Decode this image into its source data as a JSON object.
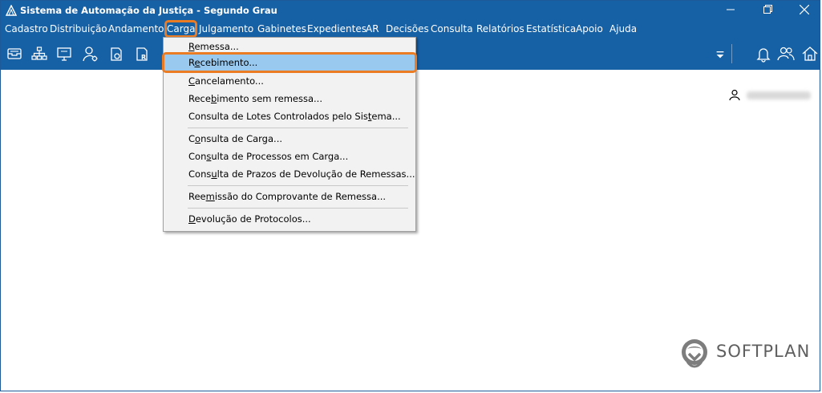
{
  "window": {
    "title": "Sistema de Automação da Justiça - Segundo Grau",
    "controls": [
      "minimize",
      "restore",
      "close"
    ]
  },
  "menubar": {
    "items": [
      {
        "label": "Cadastro"
      },
      {
        "label": "Distribuição"
      },
      {
        "label": "Andamento"
      },
      {
        "label": "Carga",
        "active": true
      },
      {
        "label": "Julgamento"
      },
      {
        "label": "Gabinetes"
      },
      {
        "label": "Expedientes"
      },
      {
        "label": "AR"
      },
      {
        "label": "Decisões"
      },
      {
        "label": "Consulta"
      },
      {
        "label": "Relatórios"
      },
      {
        "label": "Estatística"
      },
      {
        "label": "Apoio"
      },
      {
        "label": "Ajuda"
      }
    ]
  },
  "toolbar": {
    "icons": [
      "inbox-icon",
      "hierarchy-icon",
      "monitor-icon",
      "user-settings-icon",
      "document-o-icon",
      "document-r-icon"
    ],
    "right_icons": [
      "dropdown-arrow-icon",
      "bell-icon",
      "users-icon",
      "home-icon"
    ]
  },
  "carga_menu": {
    "items": [
      {
        "label": "Remessa...",
        "mnemonic_index": 0
      },
      {
        "label": "Recebimento...",
        "mnemonic_index": 1,
        "highlighted": true
      },
      {
        "label": "Cancelamento...",
        "mnemonic_index": 0
      },
      {
        "label": "Recebimento sem remessa...",
        "mnemonic_index": 4
      },
      {
        "label": "Consulta de Lotes Controlados pelo Sistema...",
        "mnemonic_index": 38
      },
      {
        "label": "Consulta de Carga...",
        "mnemonic_index": 1
      },
      {
        "label": "Consulta de Processos em Carga...",
        "mnemonic_index": 3
      },
      {
        "label": "Consulta de Prazos de Devolução de Remessas...",
        "mnemonic_index": 4
      },
      {
        "label": "Reemissão do Comprovante de Remessa...",
        "mnemonic_index": 3
      },
      {
        "label": "Devolução de Protocolos...",
        "mnemonic_index": 0
      }
    ]
  },
  "brand": {
    "name": "SOFTPLAN"
  },
  "colors": {
    "titlebar": "#1660a6",
    "highlight": "#99c9ef",
    "focus_outline": "#ec7c24"
  }
}
